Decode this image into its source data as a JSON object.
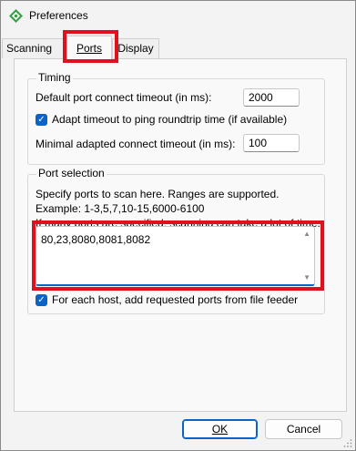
{
  "window": {
    "title": "Preferences",
    "app_icon": "angry-ip-scanner-icon"
  },
  "tabs": [
    {
      "label": "Scanning",
      "active": false
    },
    {
      "label": "Ports",
      "active": true
    },
    {
      "label": "Display",
      "active": false
    }
  ],
  "timing": {
    "legend": "Timing",
    "default_timeout_label": "Default port connect timeout (in ms):",
    "default_timeout_value": "2000",
    "adapt_label": "Adapt timeout to ping roundtrip time (if available)",
    "adapt_checked": true,
    "min_timeout_label": "Minimal adapted connect timeout (in ms):",
    "min_timeout_value": "100"
  },
  "port_selection": {
    "legend": "Port selection",
    "help_line1": "Specify ports to scan here. Ranges are supported.",
    "help_line2": "Example: 1-3,5,7,10-15,6000-6100",
    "help_line3": "If many ports are specified, scanning can take a lot of time.",
    "ports_value": "80,23,8080,8081,8082",
    "feeder_label": "For each host, add requested ports from file feeder",
    "feeder_checked": true
  },
  "buttons": {
    "ok": "OK",
    "cancel": "Cancel"
  },
  "colors": {
    "highlight": "#e0101c",
    "accent": "#0b63c6"
  }
}
